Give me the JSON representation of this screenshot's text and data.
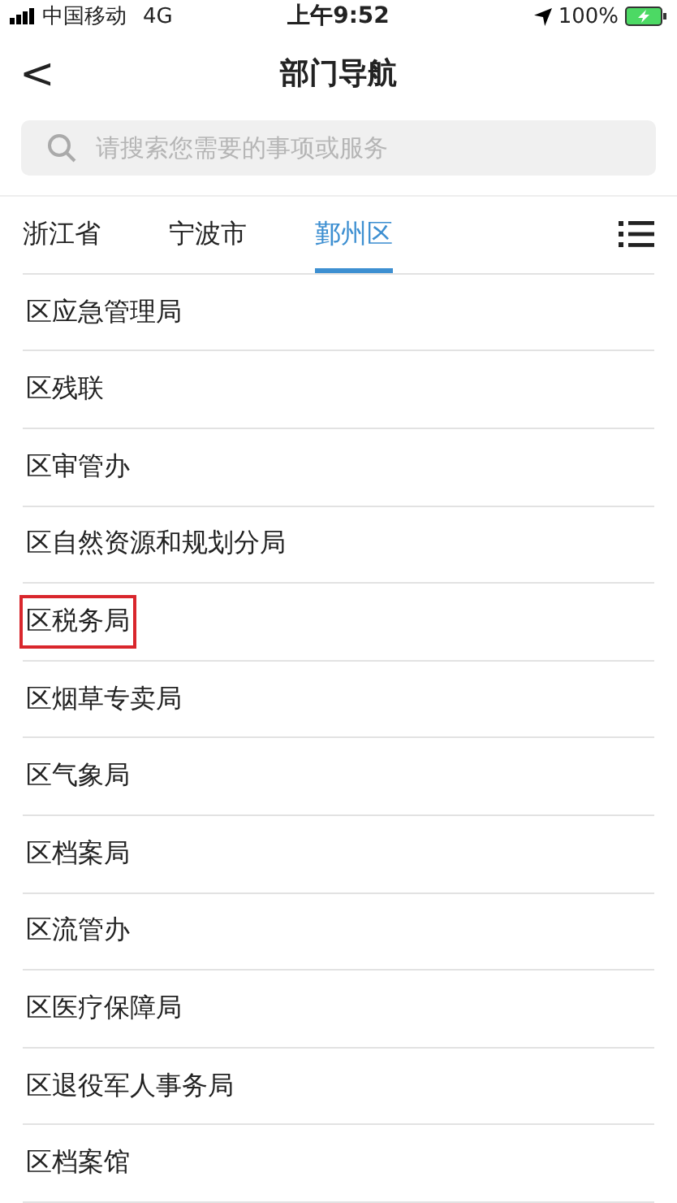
{
  "status_bar": {
    "carrier": "中国移动",
    "network": "4G",
    "time": "上午9:52",
    "battery": "100%"
  },
  "nav": {
    "back": "<",
    "title": "部门导航"
  },
  "search": {
    "placeholder": "请搜索您需要的事项或服务"
  },
  "tabs": [
    {
      "label": "浙江省",
      "selected": false
    },
    {
      "label": "宁波市",
      "selected": false
    },
    {
      "label": "鄞州区",
      "selected": true
    }
  ],
  "departments": [
    {
      "name": "区应急管理局",
      "highlighted": false
    },
    {
      "name": "区残联",
      "highlighted": false
    },
    {
      "name": "区审管办",
      "highlighted": false
    },
    {
      "name": "区自然资源和规划分局",
      "highlighted": false
    },
    {
      "name": "区税务局",
      "highlighted": true
    },
    {
      "name": "区烟草专卖局",
      "highlighted": false
    },
    {
      "name": "区气象局",
      "highlighted": false
    },
    {
      "name": "区档案局",
      "highlighted": false
    },
    {
      "name": "区流管办",
      "highlighted": false
    },
    {
      "name": "区医疗保障局",
      "highlighted": false
    },
    {
      "name": "区退役军人事务局",
      "highlighted": false
    },
    {
      "name": "区档案馆",
      "highlighted": false
    }
  ]
}
